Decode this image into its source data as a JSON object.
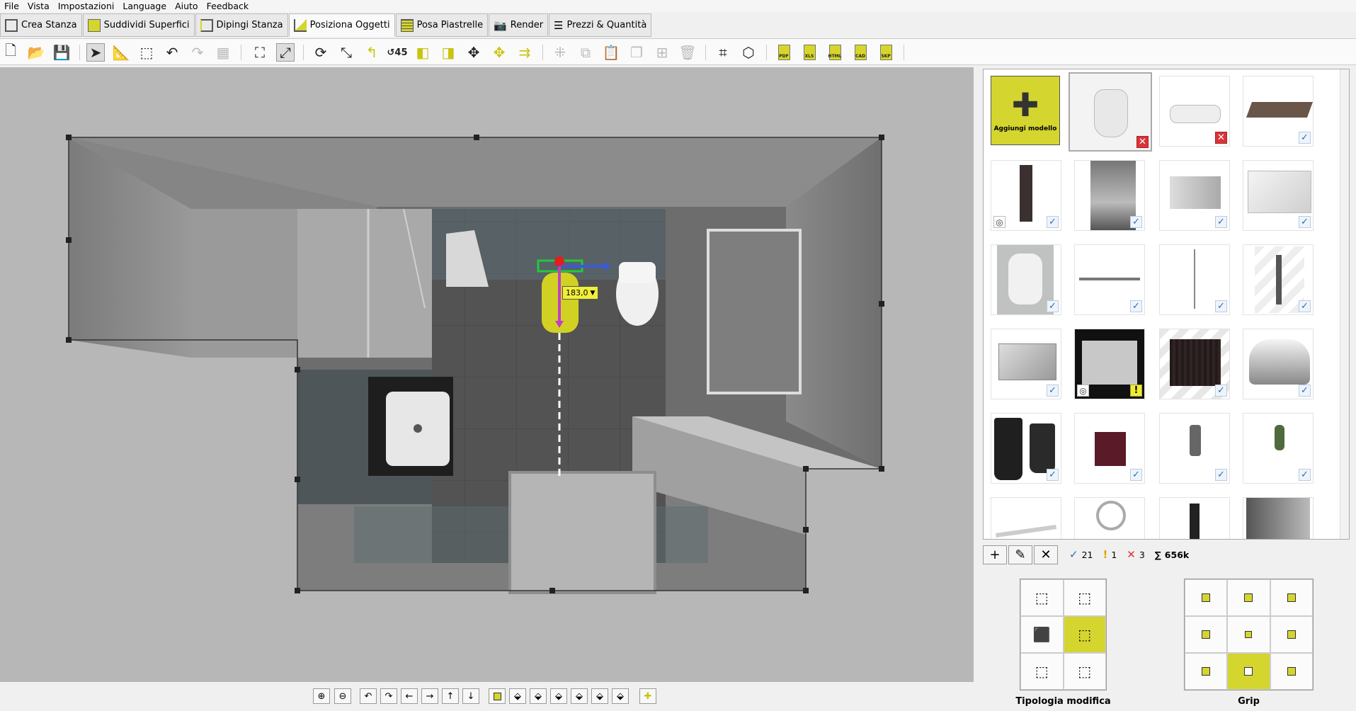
{
  "menu": [
    "File",
    "Vista",
    "Impostazioni",
    "Language",
    "Aiuto",
    "Feedback"
  ],
  "tabs": [
    "Crea Stanza",
    "Suddividi Superfici",
    "Dipingi Stanza",
    "Posiziona Oggetti",
    "Posa Piastrelle",
    "Render",
    "Prezzi & Quantità"
  ],
  "active_tab": "Posiziona Oggetti",
  "toolbar": {
    "export_labels": [
      "PDF",
      "XLS",
      "HTML",
      "CAD",
      "SKP"
    ]
  },
  "viewport": {
    "dimension_value": "183,0"
  },
  "catalog": {
    "add_label": "Aggiungi modello"
  },
  "status": {
    "ok_count": "21",
    "warn_count": "1",
    "err_count": "3",
    "total": "656k",
    "sum_symbol": "∑"
  },
  "panels": {
    "edit_type_label": "Tipologia modifica",
    "grip_label": "Grip"
  },
  "colors": {
    "accent": "#d4d52f",
    "check": "#2a6db5",
    "error": "#d9343a"
  }
}
